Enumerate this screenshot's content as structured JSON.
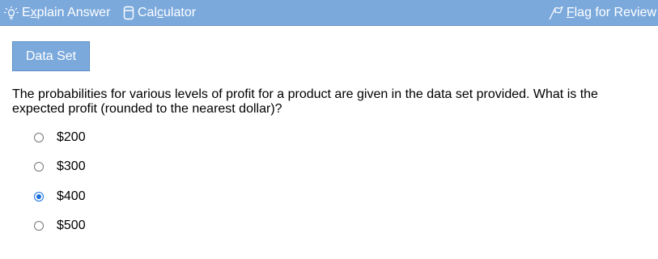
{
  "toolbar": {
    "explain_pre": "E",
    "explain_u": "x",
    "explain_post": "plain Answer",
    "calc_pre": "Cal",
    "calc_u": "c",
    "calc_post": "ulator",
    "flag_u": "F",
    "flag_post": "lag for Review",
    "icons": {
      "explain": "lightbulb-icon",
      "calculator": "calculator-icon",
      "flag": "flag-icon"
    }
  },
  "dataset_button": "Data Set",
  "question": "The probabilities for various levels of profit for a product are given in the data set provided. What is the expected profit (rounded to the nearest dollar)?",
  "options": [
    {
      "label": "$200",
      "selected": false
    },
    {
      "label": "$300",
      "selected": false
    },
    {
      "label": "$400",
      "selected": true
    },
    {
      "label": "$500",
      "selected": false
    }
  ],
  "colors": {
    "toolbar_bg": "#7ba9dc",
    "button_bg": "#7ba9dc",
    "radio_selected": "#1a6fdd"
  }
}
